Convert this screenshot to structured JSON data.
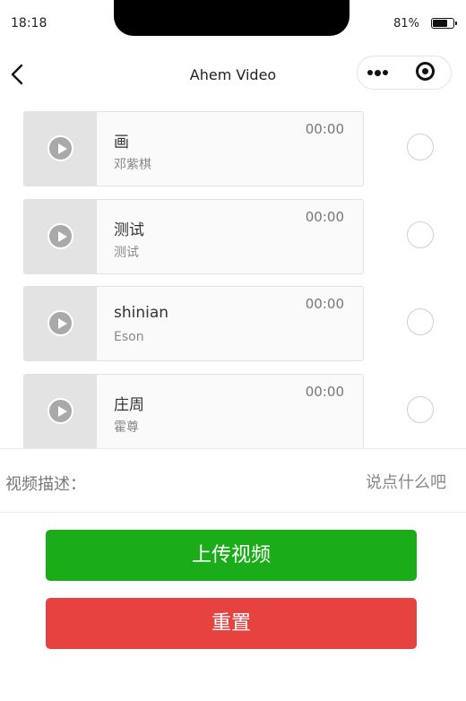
{
  "status_bar": {
    "time": "18:18",
    "battery_percent": "81%",
    "battery_level": 0.81
  },
  "nav": {
    "title": "Ahem Video",
    "back_icon": "chevron-left-icon",
    "more_icon": "more-dots-icon",
    "close_icon": "target-close-icon"
  },
  "videos": [
    {
      "title": "画",
      "author": "邓紫棋",
      "duration": "00:00",
      "selected": false
    },
    {
      "title": "测试",
      "author": "测试",
      "duration": "00:00",
      "selected": false
    },
    {
      "title": "shinian",
      "author": "Eson",
      "duration": "00:00",
      "selected": false
    },
    {
      "title": "庄周",
      "author": "霍尊",
      "duration": "00:00",
      "selected": false
    }
  ],
  "description": {
    "label": "视频描述：",
    "placeholder": "说点什么吧",
    "value": ""
  },
  "buttons": {
    "upload": "上传视频",
    "reset": "重置"
  },
  "colors": {
    "upload": "#1aad19",
    "reset": "#e64340",
    "thumb": "#e3e3e3"
  }
}
